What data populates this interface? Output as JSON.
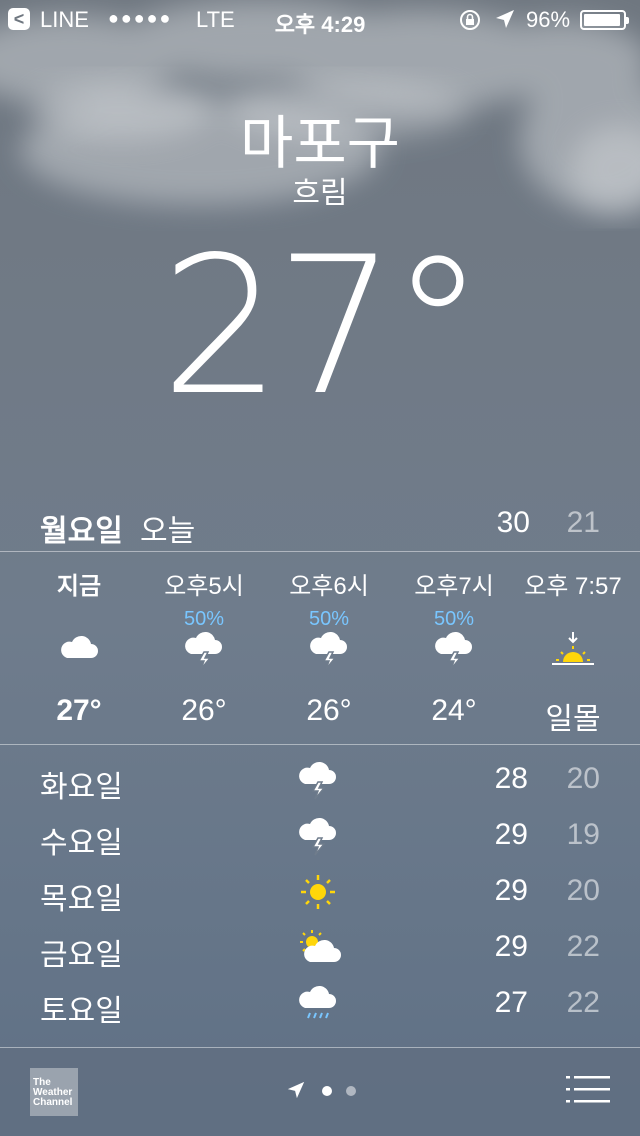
{
  "status_bar": {
    "back_app": "LINE",
    "signal_dots": "●●●●●",
    "network": "LTE",
    "time": "오후 4:29",
    "battery": "96%",
    "battery_level": 0.96
  },
  "current": {
    "location": "마포구",
    "condition": "흐림",
    "temperature": "27°"
  },
  "today": {
    "day": "월요일",
    "label": "오늘",
    "high": "30",
    "low": "21"
  },
  "hourly": [
    {
      "time": "지금",
      "pop": "",
      "icon": "cloud-icon",
      "temp": "27°"
    },
    {
      "time": "오후5시",
      "pop": "50%",
      "icon": "thunderstorm-icon",
      "temp": "26°"
    },
    {
      "time": "오후6시",
      "pop": "50%",
      "icon": "thunderstorm-icon",
      "temp": "26°"
    },
    {
      "time": "오후7시",
      "pop": "50%",
      "icon": "thunderstorm-icon",
      "temp": "24°"
    },
    {
      "time": "오후 7:57",
      "pop": "",
      "icon": "sunset-icon",
      "temp": "일몰"
    }
  ],
  "daily": [
    {
      "day": "화요일",
      "icon": "thunderstorm-icon",
      "high": "28",
      "low": "20"
    },
    {
      "day": "수요일",
      "icon": "thunderstorm-icon",
      "high": "29",
      "low": "19"
    },
    {
      "day": "목요일",
      "icon": "sun-icon",
      "high": "29",
      "low": "20"
    },
    {
      "day": "금요일",
      "icon": "partly-cloudy-icon",
      "high": "29",
      "low": "22"
    },
    {
      "day": "토요일",
      "icon": "rain-icon",
      "high": "27",
      "low": "22"
    }
  ],
  "footer": {
    "logo_text": "The Weather Channel",
    "page_count": 2,
    "current_page": 1
  },
  "colors": {
    "precip_blue": "#79c6ff",
    "sun_yellow": "#ffd60a"
  }
}
